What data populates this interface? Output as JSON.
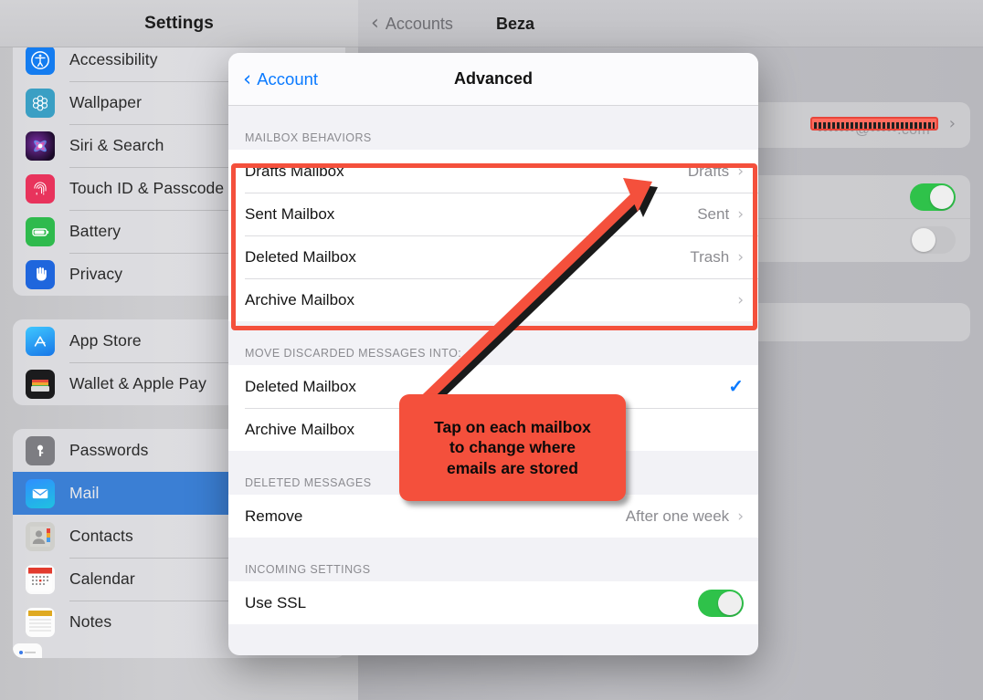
{
  "sidebar": {
    "title": "Settings",
    "groups": [
      {
        "items": [
          {
            "label": "Accessibility",
            "icon": "accessibility-icon",
            "selected": false
          },
          {
            "label": "Wallpaper",
            "icon": "wallpaper-icon",
            "selected": false
          },
          {
            "label": "Siri & Search",
            "icon": "siri-icon",
            "selected": false
          },
          {
            "label": "Touch ID & Passcode",
            "icon": "touchid-icon",
            "selected": false
          },
          {
            "label": "Battery",
            "icon": "battery-icon",
            "selected": false
          },
          {
            "label": "Privacy",
            "icon": "privacy-hand-icon",
            "selected": false
          }
        ]
      },
      {
        "items": [
          {
            "label": "App Store",
            "icon": "appstore-icon",
            "selected": false
          },
          {
            "label": "Wallet & Apple Pay",
            "icon": "wallet-icon",
            "selected": false
          }
        ]
      },
      {
        "items": [
          {
            "label": "Passwords",
            "icon": "passwords-key-icon",
            "selected": false
          },
          {
            "label": "Mail",
            "icon": "mail-envelope-icon",
            "selected": true
          },
          {
            "label": "Contacts",
            "icon": "contacts-icon",
            "selected": false
          },
          {
            "label": "Calendar",
            "icon": "calendar-icon",
            "selected": false
          },
          {
            "label": "Notes",
            "icon": "notes-icon",
            "selected": false
          }
        ]
      }
    ]
  },
  "detail": {
    "back_label": "Accounts",
    "back_icon": "chevron-left-icon",
    "title": "Beza",
    "account_row": {
      "value_redacted": true,
      "ghost_text": "•••••••@•••••.com",
      "chevron": "chevron-right-icon"
    },
    "toggles": [
      {
        "state": "on",
        "color": "#2fc24a"
      },
      {
        "state": "off",
        "color": "#c4c4c7"
      }
    ]
  },
  "modal": {
    "back_label": "Account",
    "back_icon": "chevron-left-icon",
    "title": "Advanced",
    "sections": [
      {
        "header": "MAILBOX BEHAVIORS",
        "rows": [
          {
            "label": "Drafts Mailbox",
            "value": "Drafts",
            "accessory": "chevron-right-icon"
          },
          {
            "label": "Sent Mailbox",
            "value": "Sent",
            "accessory": "chevron-right-icon"
          },
          {
            "label": "Deleted Mailbox",
            "value": "Trash",
            "accessory": "chevron-right-icon"
          },
          {
            "label": "Archive Mailbox",
            "value": "",
            "accessory": "chevron-right-icon"
          }
        ]
      },
      {
        "header": "MOVE DISCARDED MESSAGES INTO:",
        "rows": [
          {
            "label": "Deleted Mailbox",
            "value": "",
            "accessory": "checkmark-icon"
          },
          {
            "label": "Archive Mailbox",
            "value": "",
            "accessory": "none"
          }
        ]
      },
      {
        "header": "DELETED MESSAGES",
        "rows": [
          {
            "label": "Remove",
            "value": "After one week",
            "accessory": "chevron-right-icon"
          }
        ]
      },
      {
        "header": "INCOMING SETTINGS",
        "rows": [
          {
            "label": "Use SSL",
            "value": "",
            "accessory": "toggle-on"
          }
        ]
      }
    ]
  },
  "annotation": {
    "highlight_color": "#f4503c",
    "callout_text": "Tap on each mailbox\nto change where\nemails are stored",
    "callout_bg": "#f4503c",
    "callout_text_color": "#0a0a0a",
    "arrow_color": "#f4503c",
    "arrow_target": "Drafts Mailbox row"
  }
}
